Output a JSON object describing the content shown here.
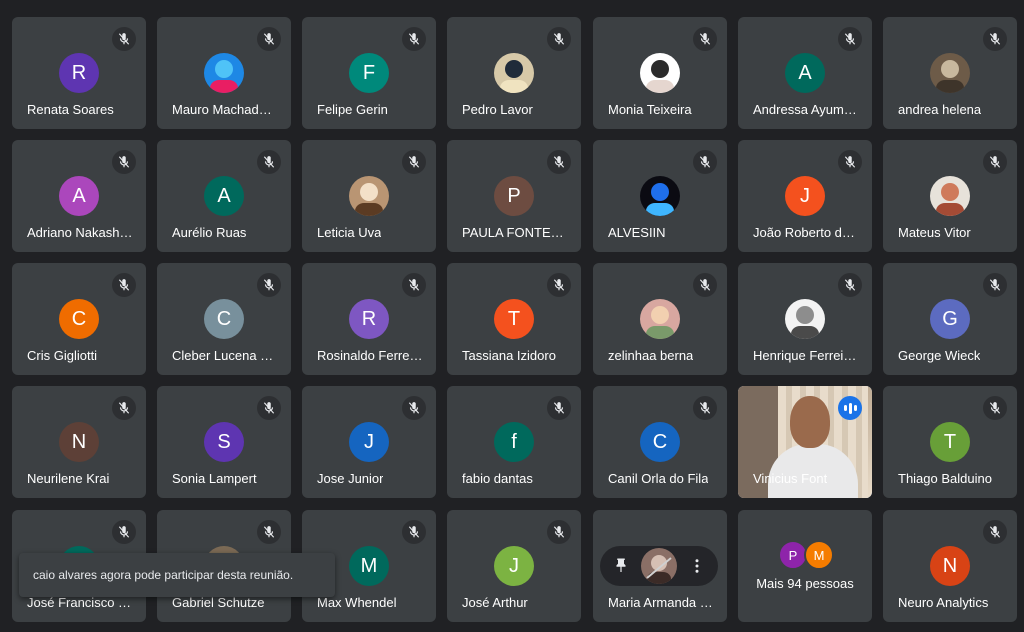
{
  "colors": {
    "background": "#202124",
    "tile": "#3c4043",
    "speaking_outline": "#8ab4f8",
    "speaking_badge": "#1a73e8"
  },
  "participants": [
    {
      "name": "Renata Soares",
      "initial": "R",
      "color": "#5e35b1"
    },
    {
      "name": "Mauro Machad…",
      "photo": true,
      "palette": [
        "#1e88e5",
        "#4fc3f7",
        "#e91e63"
      ]
    },
    {
      "name": "Felipe Gerin",
      "initial": "F",
      "color": "#00897b"
    },
    {
      "name": "Pedro Lavor",
      "photo": true,
      "palette": [
        "#d7c9a8",
        "#1f2b3a",
        "#f0e3c0"
      ]
    },
    {
      "name": "Monia Teixeira",
      "photo": true,
      "palette": [
        "#ffffff",
        "#2b2b2b",
        "#e5d6cf"
      ]
    },
    {
      "name": "Andressa Ayum…",
      "initial": "A",
      "color": "#00695c"
    },
    {
      "name": "andrea helena",
      "photo": true,
      "palette": [
        "#6d5b48",
        "#c8b89e",
        "#3e342a"
      ]
    },
    {
      "name": "Adriano Nakash…",
      "initial": "A",
      "color": "#ab47bc"
    },
    {
      "name": "Aurélio Ruas",
      "initial": "A",
      "color": "#00695c"
    },
    {
      "name": "Leticia Uva",
      "photo": true,
      "palette": [
        "#b99573",
        "#f3e0c8",
        "#5b3b23"
      ]
    },
    {
      "name": "PAULA FONTES…",
      "initial": "P",
      "color": "#6d4c41"
    },
    {
      "name": "ALVESIIN",
      "photo": true,
      "palette": [
        "#0b0b12",
        "#1f6feb",
        "#3fb6ff"
      ]
    },
    {
      "name": "João Roberto d…",
      "initial": "J",
      "color": "#f4511e"
    },
    {
      "name": "Mateus Vitor",
      "photo": true,
      "palette": [
        "#e7e2da",
        "#cf7a5b",
        "#a44b35"
      ]
    },
    {
      "name": "Cris Gigliotti",
      "initial": "C",
      "color": "#ef6c00"
    },
    {
      "name": "Cleber Lucena …",
      "initial": "C",
      "color": "#78909c"
    },
    {
      "name": "Rosinaldo Ferre…",
      "initial": "R",
      "color": "#7e57c2"
    },
    {
      "name": "Tassiana Izidoro",
      "initial": "T",
      "color": "#f4511e"
    },
    {
      "name": "zelinhaa berna",
      "photo": true,
      "palette": [
        "#d8a7a0",
        "#f2d0b0",
        "#7a9a6a"
      ]
    },
    {
      "name": "Henrique Ferrei…",
      "photo": true,
      "palette": [
        "#f3f3f3",
        "#8d8d8d",
        "#4a4a4a"
      ]
    },
    {
      "name": "George Wieck",
      "initial": "G",
      "color": "#5c6bc0"
    },
    {
      "name": "Neurilene Krai",
      "initial": "N",
      "color": "#5d4037"
    },
    {
      "name": "Sonia Lampert",
      "initial": "S",
      "color": "#5e35b1"
    },
    {
      "name": "Jose Junior",
      "initial": "J",
      "color": "#1565c0"
    },
    {
      "name": "fabio dantas",
      "initial": "f",
      "color": "#00695c"
    },
    {
      "name": "Canil Orla do Fila",
      "initial": "C",
      "color": "#1565c0"
    },
    {
      "name": "Vinicius Font",
      "video": true,
      "speaking": true
    },
    {
      "name": "Thiago Balduino",
      "initial": "T",
      "color": "#689f38"
    },
    {
      "name": "José Francisco …",
      "initial": "",
      "color": "#00695c"
    },
    {
      "name": "Gabriel Schutze",
      "photo": true,
      "palette": [
        "#7b6a55",
        "#d0b58e",
        "#3b2f25"
      ]
    },
    {
      "name": "Max Whendel",
      "initial": "M",
      "color": "#00695c"
    },
    {
      "name": "José Arthur",
      "initial": "J",
      "color": "#7cb342"
    },
    {
      "name": "Maria Armanda …",
      "hovered": true,
      "photo": true,
      "palette": [
        "#8a6f66",
        "#d6c0b4",
        "#3b2b27"
      ]
    },
    {
      "more": true,
      "label": "Mais 94 pessoas",
      "mini": [
        {
          "initial": "P",
          "color": "#8e24aa"
        },
        {
          "initial": "M",
          "color": "#f57c00"
        }
      ]
    },
    {
      "name": "Neuro Analytics",
      "initial": "N",
      "color": "#d84315"
    }
  ],
  "toast": {
    "text": "caio alvares agora pode participar desta reunião."
  },
  "hover_controls": {
    "pin_icon": "pin-icon",
    "more_icon": "more-vert-icon"
  }
}
